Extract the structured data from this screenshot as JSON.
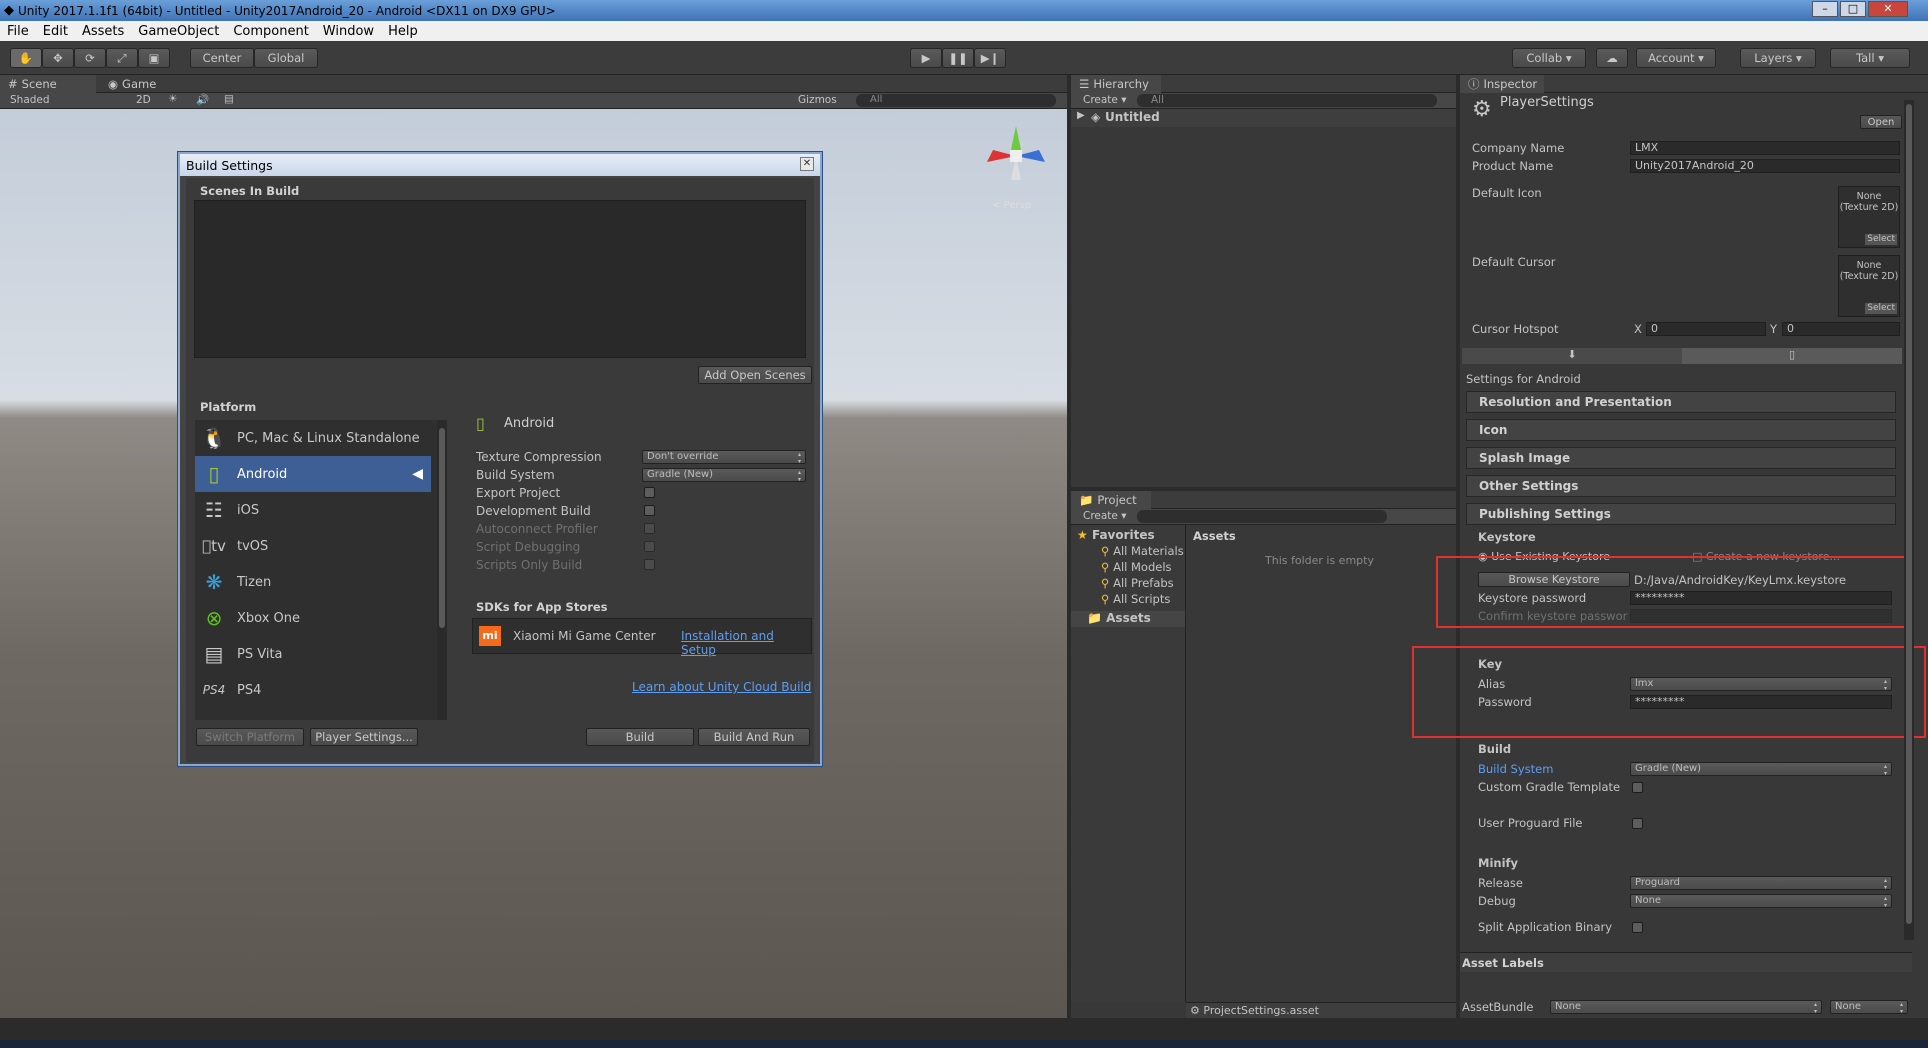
{
  "window": {
    "title": "Unity 2017.1.1f1 (64bit) - Untitled - Unity2017Android_20 - Android <DX11 on DX9 GPU>"
  },
  "menu": [
    "File",
    "Edit",
    "Assets",
    "GameObject",
    "Component",
    "Window",
    "Help"
  ],
  "toolbar": {
    "center": "Center",
    "global": "Global",
    "collab": "Collab",
    "account": "Account",
    "layers": "Layers",
    "layout": "Tall"
  },
  "scene_tabs": {
    "scene": "Scene",
    "game": "Game",
    "shaded": "Shaded",
    "mode2d": "2D",
    "gizmos": "Gizmos",
    "search": "All",
    "persp": "< Persp"
  },
  "build": {
    "title": "Build Settings",
    "scenes_header": "Scenes In Build",
    "add_open_scenes": "Add Open Scenes",
    "platform_header": "Platform",
    "platforms": [
      "PC, Mac & Linux Standalone",
      "Android",
      "iOS",
      "tvOS",
      "Tizen",
      "Xbox One",
      "PS Vita",
      "PS4"
    ],
    "selected_platform": "Android",
    "texture_compression_label": "Texture Compression",
    "texture_compression": "Don't override",
    "build_system_label": "Build System",
    "build_system": "Gradle (New)",
    "export_project": "Export Project",
    "development_build": "Development Build",
    "autoconnect_profiler": "Autoconnect Profiler",
    "script_debugging": "Script Debugging",
    "scripts_only_build": "Scripts Only Build",
    "sdks_header": "SDKs for App Stores",
    "sdk_name": "Xiaomi Mi Game Center",
    "sdk_link": "Installation and Setup",
    "cloud_link": "Learn about Unity Cloud Build",
    "switch_platform": "Switch Platform",
    "player_settings": "Player Settings...",
    "build": "Build",
    "build_and_run": "Build And Run"
  },
  "hierarchy": {
    "tab": "Hierarchy",
    "create": "Create",
    "search": "All",
    "scene": "Untitled"
  },
  "project": {
    "tab": "Project",
    "create": "Create",
    "favorites": "Favorites",
    "fav_items": [
      "All Materials",
      "All Models",
      "All Prefabs",
      "All Scripts"
    ],
    "assets": "Assets",
    "assets_header": "Assets",
    "empty": "This folder is empty",
    "footer": "ProjectSettings.asset"
  },
  "inspector": {
    "tab": "Inspector",
    "object": "PlayerSettings",
    "open": "Open",
    "company_label": "Company Name",
    "company": "LMX",
    "product_label": "Product Name",
    "product": "Unity2017Android_20",
    "default_icon": "Default Icon",
    "default_cursor": "Default Cursor",
    "texture_none": "None (Texture 2D)",
    "select": "Select",
    "cursor_hotspot": "Cursor Hotspot",
    "hx_label": "X",
    "hx": "0",
    "hy_label": "Y",
    "hy": "0",
    "settings_for": "Settings for Android",
    "sections": [
      "Resolution and Presentation",
      "Icon",
      "Splash Image",
      "Other Settings",
      "Publishing Settings"
    ],
    "keystore": "Keystore",
    "use_existing": "Use Existing Keystore",
    "create_new": "Create a new keystore...",
    "browse_keystore": "Browse Keystore",
    "keystore_path": "D:/Java/AndroidKey/KeyLmx.keystore",
    "keystore_password_label": "Keystore password",
    "keystore_password": "*********",
    "confirm_password_label": "Confirm keystore passwor",
    "key": "Key",
    "alias_label": "Alias",
    "alias": "lmx",
    "password_label": "Password",
    "password": "*********",
    "build_header": "Build",
    "build_system_label": "Build System",
    "build_system": "Gradle (New)",
    "custom_gradle": "Custom Gradle Template",
    "user_proguard": "User Proguard File",
    "minify": "Minify",
    "release_label": "Release",
    "release": "Proguard",
    "debug_label": "Debug",
    "debug": "None",
    "split_binary": "Split Application Binary",
    "asset_labels": "Asset Labels",
    "asset_bundle_label": "AssetBundle",
    "asset_bundle": "None",
    "asset_variant": "None"
  }
}
